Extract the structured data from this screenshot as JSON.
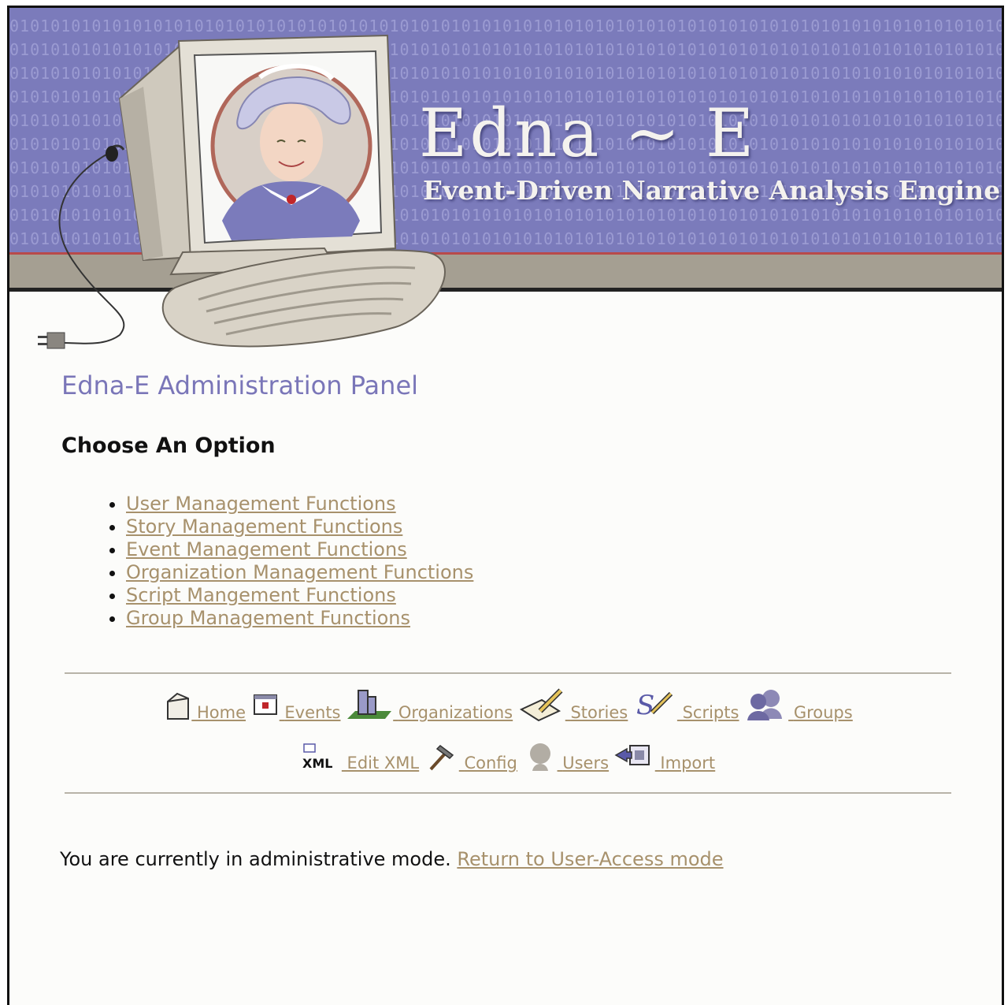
{
  "header": {
    "binary_pattern": "0101010101010101010101010101010101010101010101010101010101010101010101010101010101010101010101010101",
    "logo_title": "Edna ~ E",
    "logo_subtitle": "Event-Driven Narrative Analysis Engine",
    "colors": {
      "banner": "#7b7bbb",
      "binary": "#9b9bd2",
      "band": "#a59f92",
      "accent_line": "#b84a4a"
    }
  },
  "main": {
    "panel_title": "Edna-E Administration Panel",
    "choose_heading": "Choose An Option",
    "options": [
      {
        "label": "User Management Functions"
      },
      {
        "label": "Story Management Functions"
      },
      {
        "label": "Event Management Functions"
      },
      {
        "label": "Organization Management Functions"
      },
      {
        "label": "Script Mangement Functions"
      },
      {
        "label": "Group Management Functions"
      }
    ]
  },
  "nav": {
    "row1": [
      {
        "label": "Home",
        "icon": "house-icon"
      },
      {
        "label": "Events",
        "icon": "calendar-icon"
      },
      {
        "label": "Organizations",
        "icon": "buildings-icon"
      },
      {
        "label": "Stories",
        "icon": "pencil-paper-icon"
      },
      {
        "label": "Scripts",
        "icon": "script-s-icon"
      },
      {
        "label": "Groups",
        "icon": "people-icon"
      }
    ],
    "row2": [
      {
        "label": "Edit XML",
        "icon": "xml-icon",
        "icon_text": "XML"
      },
      {
        "label": "Config",
        "icon": "hammer-icon"
      },
      {
        "label": "Users",
        "icon": "user-head-icon"
      },
      {
        "label": "Import",
        "icon": "import-icon"
      }
    ]
  },
  "footer": {
    "status_text": "You are currently in administrative mode. ",
    "return_link": "Return to User-Access mode"
  },
  "link_color": "#a7916c",
  "title_color": "#7a76b8"
}
